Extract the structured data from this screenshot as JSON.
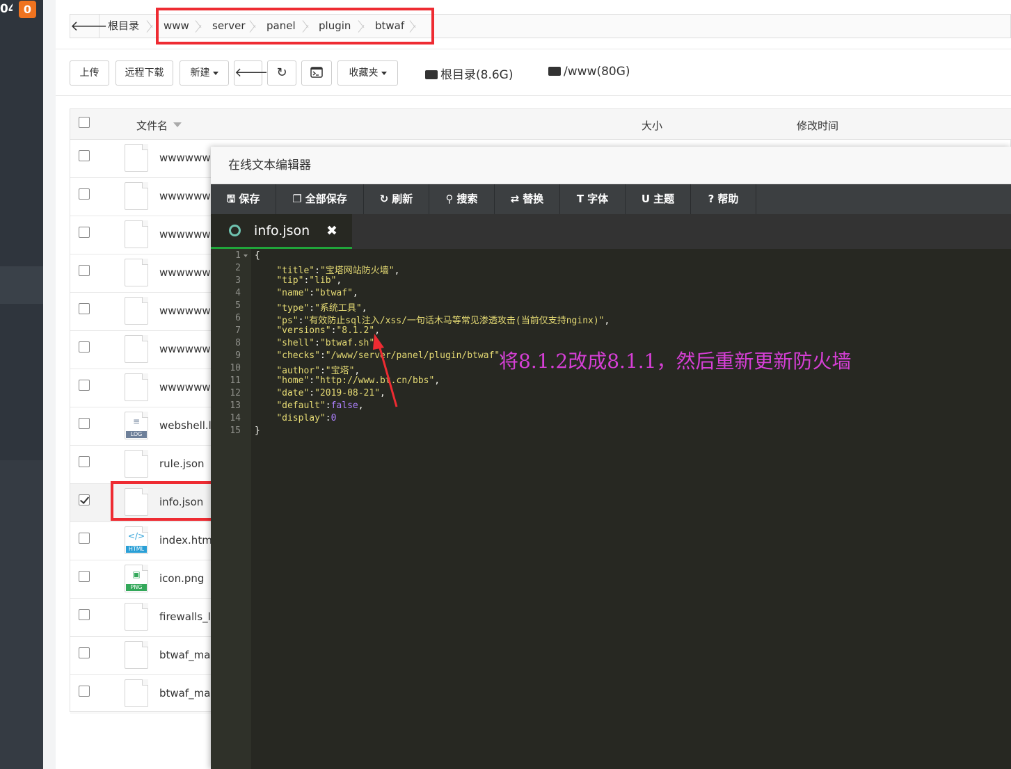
{
  "sidebar": {
    "count": "04",
    "badge": "0"
  },
  "breadcrumb": {
    "back_icon": "arrow-left-icon",
    "items": [
      "根目录",
      "www",
      "server",
      "panel",
      "plugin",
      "btwaf"
    ]
  },
  "toolbar": {
    "upload": "上传",
    "remote_download": "远程下载",
    "new": "新建",
    "favorites": "收藏夹",
    "disk_root": "根目录(8.6G)",
    "disk_www": "/www(80G)"
  },
  "table": {
    "col_name": "文件名",
    "col_size": "大小",
    "col_mtime": "修改时间",
    "rows": [
      {
        "name": "wwwwwwwwwww",
        "type": "file",
        "checked": false
      },
      {
        "name": "wwwwwwwwwww",
        "type": "file",
        "checked": false
      },
      {
        "name": "wwwwwwwwwww",
        "type": "file",
        "checked": false
      },
      {
        "name": "wwwwwwwwwww",
        "type": "file",
        "checked": false
      },
      {
        "name": "wwwwwwwwwww",
        "type": "file",
        "checked": false
      },
      {
        "name": "wwwwwwwwwww",
        "type": "file",
        "checked": false
      },
      {
        "name": "wwwwwwwwwww",
        "type": "file",
        "checked": false
      },
      {
        "name": "webshell.log",
        "type": "log",
        "tag": "LOG",
        "checked": false
      },
      {
        "name": "rule.json",
        "type": "file",
        "checked": false
      },
      {
        "name": "info.json",
        "type": "file",
        "checked": true
      },
      {
        "name": "index.html",
        "type": "html",
        "tag": "HTML",
        "checked": false
      },
      {
        "name": "icon.png",
        "type": "png",
        "tag": "PNG",
        "checked": false
      },
      {
        "name": "firewalls_list",
        "type": "file",
        "checked": false
      },
      {
        "name": "btwaf_main",
        "type": "file",
        "checked": false
      },
      {
        "name": "btwaf_main",
        "type": "file",
        "checked": false
      }
    ]
  },
  "editor": {
    "title": "在线文本编辑器",
    "buttons": [
      {
        "label": "保存",
        "icon": "save-icon"
      },
      {
        "label": "全部保存",
        "icon": "copy-icon"
      },
      {
        "label": "刷新",
        "icon": "refresh-icon"
      },
      {
        "label": "搜索",
        "icon": "search-icon"
      },
      {
        "label": "替换",
        "icon": "retweet-icon"
      },
      {
        "label": "字体",
        "icon": "text-icon"
      },
      {
        "label": "主题",
        "icon": "magnet-icon"
      },
      {
        "label": "帮助",
        "icon": "help-icon"
      }
    ],
    "tab_name": "info.json",
    "lines": [
      "{",
      "    \"title\":\"宝塔网站防火墙\",",
      "    \"tip\":\"lib\",",
      "    \"name\":\"btwaf\",",
      "    \"type\":\"系统工具\",",
      "    \"ps\":\"有效防止sql注入/xss/一句话木马等常见渗透攻击(当前仅支持nginx)\",",
      "    \"versions\":\"8.1.2\",",
      "    \"shell\":\"btwaf.sh\",",
      "    \"checks\":\"/www/server/panel/plugin/btwaf\",",
      "    \"author\":\"宝塔\",",
      "    \"home\":\"http://www.bt.cn/bbs\",",
      "    \"date\":\"2019-08-21\",",
      "    \"default\":false,",
      "    \"display\":0",
      "}"
    ]
  },
  "annotation": "将8.1.2改成8.1.1，然后重新更新防火墙",
  "colors": {
    "accent_red": "#ee2b32",
    "annotation": "#d63fd6",
    "editor_bg": "#272822",
    "tab_active": "#20a53a"
  }
}
